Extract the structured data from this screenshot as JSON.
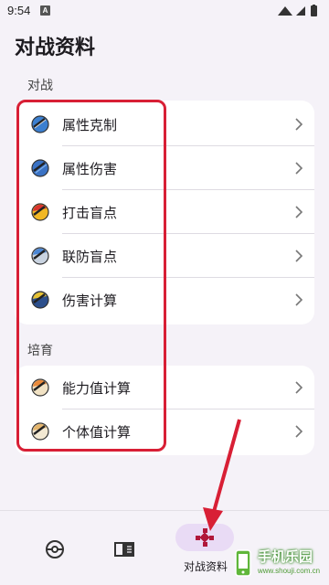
{
  "status_bar": {
    "time": "9:54",
    "notification_badge": "A"
  },
  "page": {
    "title": "对战资料"
  },
  "sections": [
    {
      "label": "对战",
      "items": [
        {
          "label": "属性克制",
          "icon": "pokeball-type-chart-icon"
        },
        {
          "label": "属性伤害",
          "icon": "pokeball-type-damage-icon"
        },
        {
          "label": "打击盲点",
          "icon": "pokeball-blind-spot-icon"
        },
        {
          "label": "联防盲点",
          "icon": "pokeball-team-defense-icon"
        },
        {
          "label": "伤害计算",
          "icon": "pokeball-damage-calc-icon"
        }
      ]
    },
    {
      "label": "培育",
      "items": [
        {
          "label": "能力值计算",
          "icon": "pokeball-stat-calc-icon"
        },
        {
          "label": "个体值计算",
          "icon": "pokeball-iv-calc-icon"
        }
      ]
    }
  ],
  "bottom_nav": {
    "items": [
      {
        "label": "",
        "icon": "pokeball-icon"
      },
      {
        "label": "",
        "icon": "book-icon"
      },
      {
        "label": "对战资料",
        "icon": "gamepad-icon",
        "selected": true
      }
    ]
  },
  "watermark": {
    "text": "手机乐园",
    "sub": "www.shouji.com.cn"
  },
  "colors": {
    "background": "#f5f2f8",
    "card": "#ffffff",
    "highlight": "#d81f35",
    "nav_pill": "#e9dbf5",
    "selected_icon": "#b0173a"
  }
}
